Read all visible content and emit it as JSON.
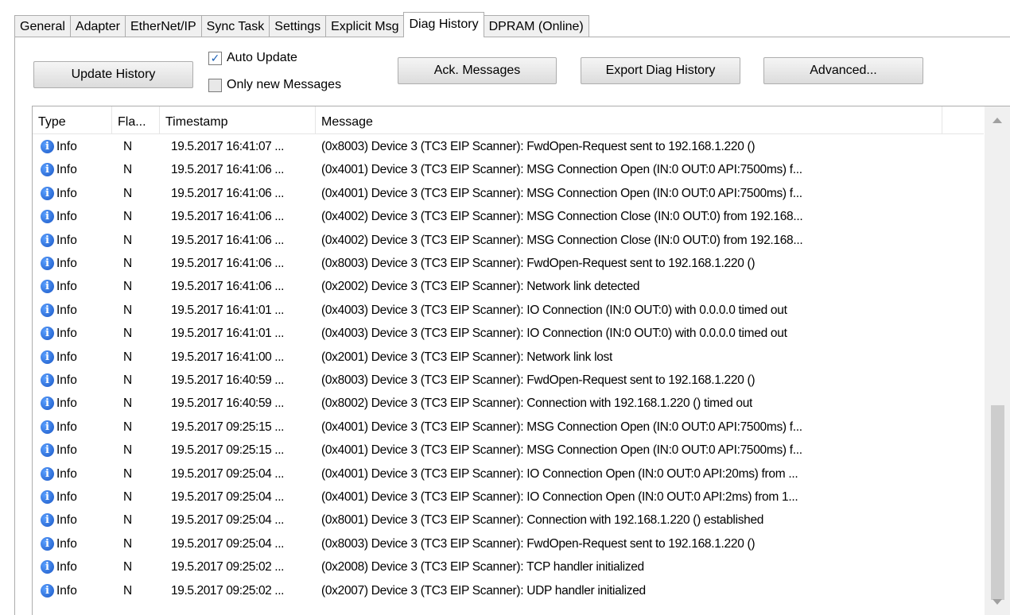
{
  "tabs": [
    {
      "label": "General",
      "active": false
    },
    {
      "label": "Adapter",
      "active": false
    },
    {
      "label": "EtherNet/IP",
      "active": false
    },
    {
      "label": "Sync Task",
      "active": false
    },
    {
      "label": "Settings",
      "active": false
    },
    {
      "label": "Explicit Msg",
      "active": false
    },
    {
      "label": "Diag History",
      "active": true
    },
    {
      "label": "DPRAM (Online)",
      "active": false
    }
  ],
  "toolbar": {
    "update_history": "Update History",
    "auto_update": "Auto Update",
    "auto_update_checked": true,
    "only_new": "Only new Messages",
    "only_new_checked": false,
    "ack_messages": "Ack. Messages",
    "export_diag": "Export Diag History",
    "advanced": "Advanced..."
  },
  "table": {
    "columns": [
      "Type",
      "Fla...",
      "Timestamp",
      "Message"
    ],
    "rows": [
      {
        "type": "Info",
        "flag": "N",
        "timestamp": "19.5.2017 16:41:07 ...",
        "message": "(0x8003) Device 3 (TC3 EIP Scanner): FwdOpen-Request sent to 192.168.1.220 ()"
      },
      {
        "type": "Info",
        "flag": "N",
        "timestamp": "19.5.2017 16:41:06 ...",
        "message": "(0x4001) Device 3 (TC3 EIP Scanner): MSG Connection Open (IN:0 OUT:0 API:7500ms) f..."
      },
      {
        "type": "Info",
        "flag": "N",
        "timestamp": "19.5.2017 16:41:06 ...",
        "message": "(0x4001) Device 3 (TC3 EIP Scanner): MSG Connection Open (IN:0 OUT:0 API:7500ms) f..."
      },
      {
        "type": "Info",
        "flag": "N",
        "timestamp": "19.5.2017 16:41:06 ...",
        "message": "(0x4002) Device 3 (TC3 EIP Scanner): MSG Connection Close (IN:0 OUT:0) from 192.168..."
      },
      {
        "type": "Info",
        "flag": "N",
        "timestamp": "19.5.2017 16:41:06 ...",
        "message": "(0x4002) Device 3 (TC3 EIP Scanner): MSG Connection Close (IN:0 OUT:0) from 192.168..."
      },
      {
        "type": "Info",
        "flag": "N",
        "timestamp": "19.5.2017 16:41:06 ...",
        "message": "(0x8003) Device 3 (TC3 EIP Scanner): FwdOpen-Request sent to 192.168.1.220 ()"
      },
      {
        "type": "Info",
        "flag": "N",
        "timestamp": "19.5.2017 16:41:06 ...",
        "message": "(0x2002) Device 3 (TC3 EIP Scanner): Network link detected"
      },
      {
        "type": "Info",
        "flag": "N",
        "timestamp": "19.5.2017 16:41:01 ...",
        "message": "(0x4003) Device 3 (TC3 EIP Scanner): IO Connection (IN:0 OUT:0) with 0.0.0.0 timed out"
      },
      {
        "type": "Info",
        "flag": "N",
        "timestamp": "19.5.2017 16:41:01 ...",
        "message": "(0x4003) Device 3 (TC3 EIP Scanner): IO Connection (IN:0 OUT:0) with 0.0.0.0 timed out"
      },
      {
        "type": "Info",
        "flag": "N",
        "timestamp": "19.5.2017 16:41:00 ...",
        "message": "(0x2001) Device 3 (TC3 EIP Scanner): Network link lost"
      },
      {
        "type": "Info",
        "flag": "N",
        "timestamp": "19.5.2017 16:40:59 ...",
        "message": "(0x8003) Device 3 (TC3 EIP Scanner): FwdOpen-Request sent to 192.168.1.220 ()"
      },
      {
        "type": "Info",
        "flag": "N",
        "timestamp": "19.5.2017 16:40:59 ...",
        "message": "(0x8002) Device 3 (TC3 EIP Scanner): Connection with 192.168.1.220 () timed out"
      },
      {
        "type": "Info",
        "flag": "N",
        "timestamp": "19.5.2017 09:25:15 ...",
        "message": "(0x4001) Device 3 (TC3 EIP Scanner): MSG Connection Open (IN:0 OUT:0 API:7500ms) f..."
      },
      {
        "type": "Info",
        "flag": "N",
        "timestamp": "19.5.2017 09:25:15 ...",
        "message": "(0x4001) Device 3 (TC3 EIP Scanner): MSG Connection Open (IN:0 OUT:0 API:7500ms) f..."
      },
      {
        "type": "Info",
        "flag": "N",
        "timestamp": "19.5.2017 09:25:04 ...",
        "message": "(0x4001) Device 3 (TC3 EIP Scanner): IO Connection Open (IN:0 OUT:0 API:20ms) from ..."
      },
      {
        "type": "Info",
        "flag": "N",
        "timestamp": "19.5.2017 09:25:04 ...",
        "message": "(0x4001) Device 3 (TC3 EIP Scanner): IO Connection Open (IN:0 OUT:0 API:2ms) from 1..."
      },
      {
        "type": "Info",
        "flag": "N",
        "timestamp": "19.5.2017 09:25:04 ...",
        "message": "(0x8001) Device 3 (TC3 EIP Scanner): Connection with 192.168.1.220 () established"
      },
      {
        "type": "Info",
        "flag": "N",
        "timestamp": "19.5.2017 09:25:04 ...",
        "message": "(0x8003) Device 3 (TC3 EIP Scanner): FwdOpen-Request sent to 192.168.1.220 ()"
      },
      {
        "type": "Info",
        "flag": "N",
        "timestamp": "19.5.2017 09:25:02 ...",
        "message": "(0x2008) Device 3 (TC3 EIP Scanner): TCP handler initialized"
      },
      {
        "type": "Info",
        "flag": "N",
        "timestamp": "19.5.2017 09:25:02 ...",
        "message": "(0x2007) Device 3 (TC3 EIP Scanner): UDP handler initialized"
      }
    ]
  },
  "icons": {
    "row_type_icon": "info-icon",
    "check_mark": "✓"
  }
}
